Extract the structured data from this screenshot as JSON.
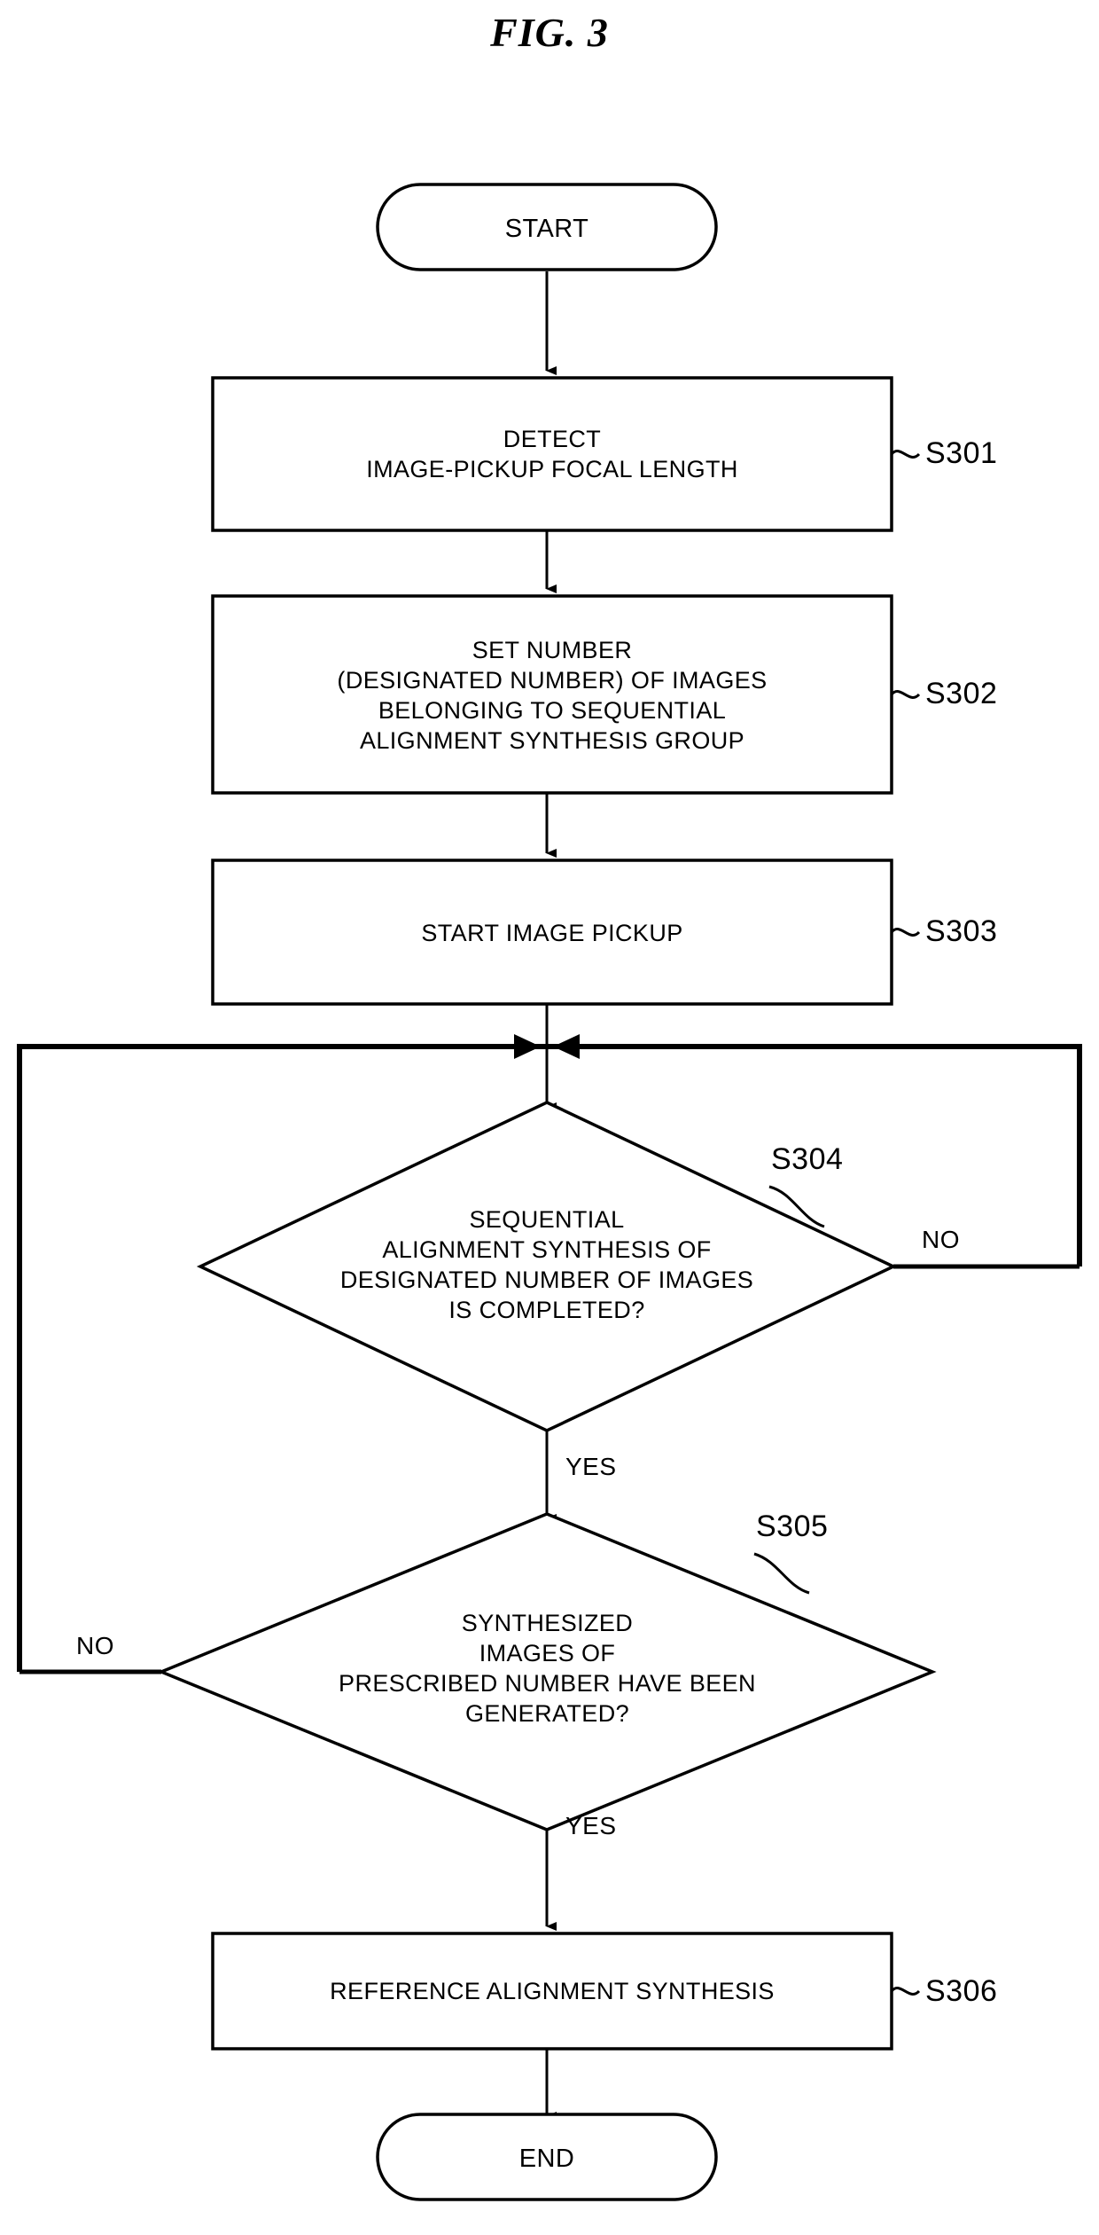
{
  "figure": {
    "title": "FIG. 3",
    "type": "flowchart"
  },
  "nodes": {
    "start": {
      "label": "START",
      "shape": "terminator"
    },
    "s301": {
      "label": "DETECT\nIMAGE-PICKUP FOCAL LENGTH",
      "shape": "process",
      "step": "S301"
    },
    "s302": {
      "label": "SET NUMBER\n(DESIGNATED NUMBER) OF IMAGES\nBELONGING TO SEQUENTIAL\nALIGNMENT SYNTHESIS GROUP",
      "shape": "process",
      "step": "S302"
    },
    "s303": {
      "label": "START IMAGE PICKUP",
      "shape": "process",
      "step": "S303"
    },
    "s304": {
      "label": "SEQUENTIAL\nALIGNMENT SYNTHESIS OF\nDESIGNATED NUMBER OF IMAGES\nIS COMPLETED?",
      "shape": "decision",
      "step": "S304"
    },
    "s305": {
      "label": "SYNTHESIZED\nIMAGES OF\nPRESCRIBED NUMBER HAVE BEEN\nGENERATED?",
      "shape": "decision",
      "step": "S305"
    },
    "s306": {
      "label": "REFERENCE ALIGNMENT SYNTHESIS",
      "shape": "process",
      "step": "S306"
    },
    "end": {
      "label": "END",
      "shape": "terminator"
    }
  },
  "edge_labels": {
    "s304_no": "NO",
    "s304_yes": "YES",
    "s305_no": "NO",
    "s305_yes": "YES"
  },
  "colors": {
    "stroke": "#000000",
    "text": "#000000",
    "background": "#ffffff"
  }
}
